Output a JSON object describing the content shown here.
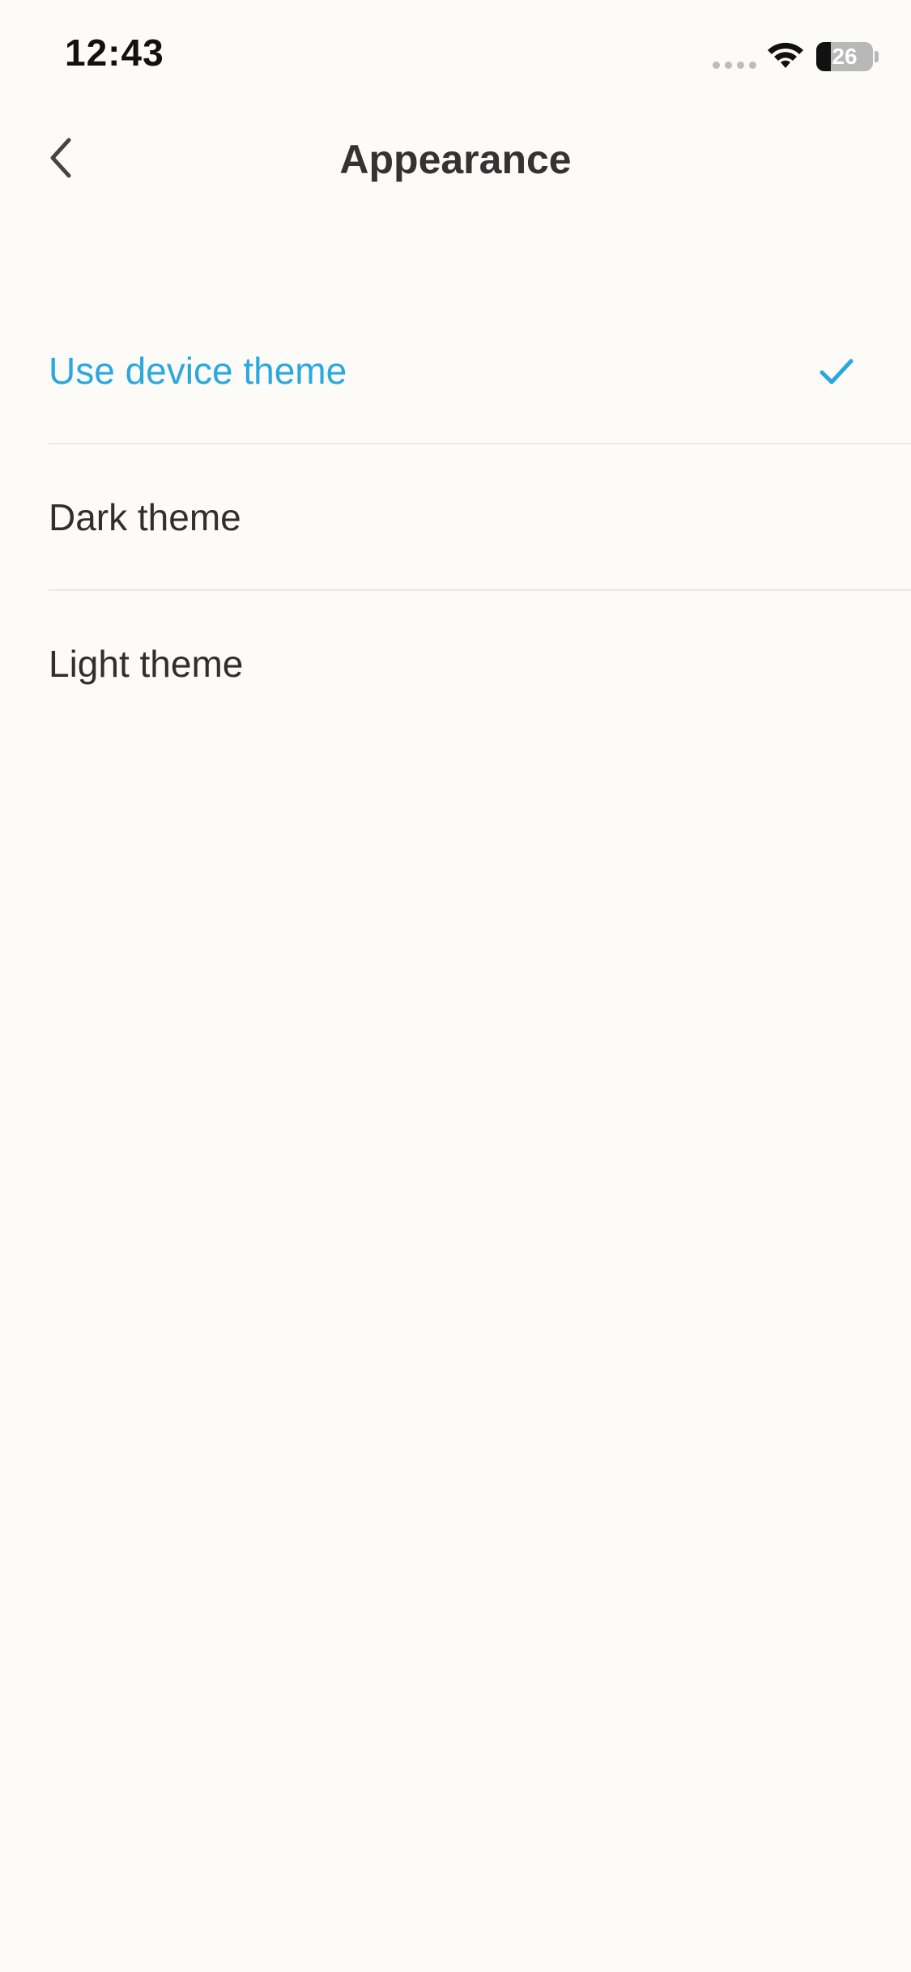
{
  "status_bar": {
    "time": "12:43",
    "battery_level": "26",
    "battery_fraction": 0.26,
    "icons": [
      "signal-icon",
      "wifi-icon",
      "battery-icon"
    ]
  },
  "header": {
    "title": "Appearance",
    "back_icon": "chevron-left-icon"
  },
  "options": [
    {
      "label": "Use device theme",
      "selected": true
    },
    {
      "label": "Dark theme",
      "selected": false
    },
    {
      "label": "Light theme",
      "selected": false
    }
  ],
  "colors": {
    "accent": "#2aa8e0",
    "background": "#fcfbf8",
    "text": "#2f2f2f",
    "divider": "#ebe9e5"
  }
}
